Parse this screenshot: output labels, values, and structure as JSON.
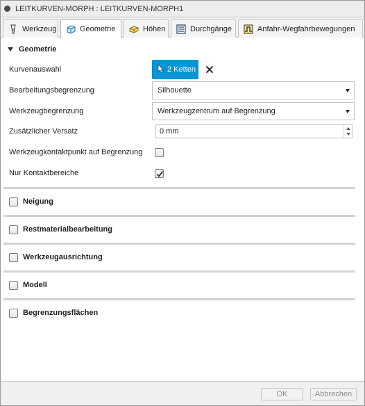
{
  "window": {
    "title": "LEITKURVEN-MORPH : LEITKURVEN-MORPH1"
  },
  "tabs": [
    {
      "label": "Werkzeug",
      "icon": "tool-icon"
    },
    {
      "label": "Geometrie",
      "icon": "geometry-cube-icon",
      "active": true
    },
    {
      "label": "Höhen",
      "icon": "heights-icon"
    },
    {
      "label": "Durchgänge",
      "icon": "passes-icon"
    },
    {
      "label": "Anfahr-Wegfahrbewegungen",
      "icon": "linking-icon"
    }
  ],
  "geometry": {
    "title": "Geometrie",
    "fields": {
      "curve_selection": {
        "label": "Kurvenauswahl",
        "button_label": "2 Ketten",
        "button_icon": "cursor-arrow-icon",
        "clear_icon": "close-icon"
      },
      "machining_boundary": {
        "label": "Bearbeitungsbegrenzung",
        "value": "Silhouette"
      },
      "tool_containment": {
        "label": "Werkzeugbegrenzung",
        "value": "Werkzeugzentrum auf Begrenzung"
      },
      "additional_offset": {
        "label": "Zusätzlicher Versatz",
        "value": "0 mm"
      },
      "contact_point": {
        "label": "Werkzeugkontaktpunkt auf Begrenzung",
        "checked": false
      },
      "contact_only": {
        "label": "Nur Kontaktbereiche",
        "checked": true
      }
    }
  },
  "sections": [
    {
      "label": "Neigung",
      "checked": false
    },
    {
      "label": "Restmaterialbearbeitung",
      "checked": false
    },
    {
      "label": "Werkzeugausrichtung",
      "checked": false
    },
    {
      "label": "Modell",
      "checked": false
    },
    {
      "label": "Begrenzungsflächen",
      "checked": false
    }
  ],
  "footer": {
    "ok_label": "OK",
    "cancel_label": "Abbrechen"
  },
  "colors": {
    "accent": "#0696d7",
    "divider": "#d3d3d3"
  }
}
